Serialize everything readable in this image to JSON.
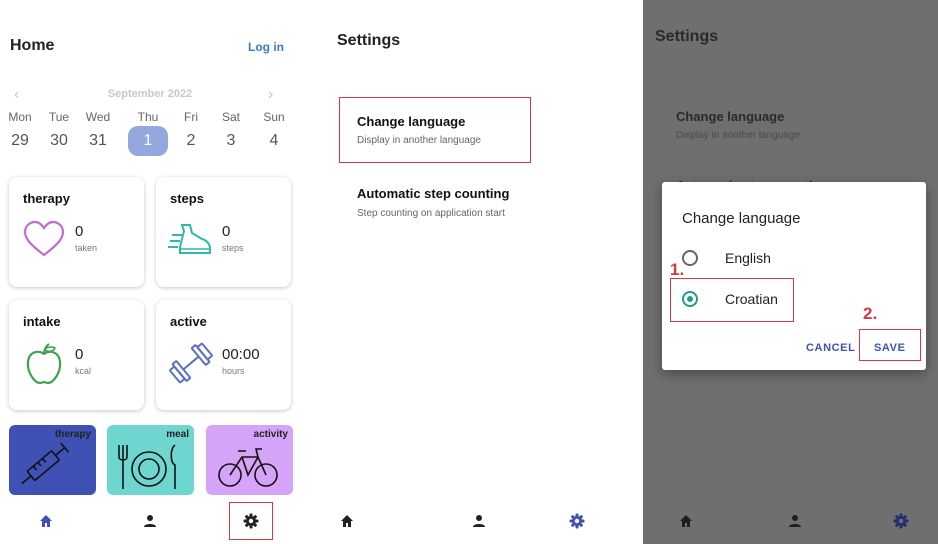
{
  "home": {
    "title": "Home",
    "login_label": "Log in",
    "calendar": {
      "prev_icon": "chevron-left-icon",
      "next_icon": "chevron-right-icon",
      "month": "September 2022",
      "days": [
        {
          "name": "Mon",
          "date": "29"
        },
        {
          "name": "Tue",
          "date": "30"
        },
        {
          "name": "Wed",
          "date": "31"
        },
        {
          "name": "Thu",
          "date": "1",
          "selected": true
        },
        {
          "name": "Fri",
          "date": "2"
        },
        {
          "name": "Sat",
          "date": "3"
        },
        {
          "name": "Sun",
          "date": "4"
        }
      ]
    },
    "cards": {
      "therapy": {
        "title": "therapy",
        "value": "0",
        "unit": "taken",
        "icon": "heart-icon"
      },
      "steps": {
        "title": "steps",
        "value": "0",
        "unit": "steps",
        "icon": "shoe-icon"
      },
      "intake": {
        "title": "intake",
        "value": "0",
        "unit": "kcal",
        "icon": "apple-icon"
      },
      "active": {
        "title": "active",
        "value": "00:00",
        "unit": "hours",
        "icon": "dumbbell-icon"
      }
    },
    "tiles": [
      {
        "label": "therapy",
        "icon": "syringe-icon",
        "color": "#3f51b5"
      },
      {
        "label": "meal",
        "icon": "cutlery-plate-icon",
        "color": "#6fd6cf"
      },
      {
        "label": "activity",
        "icon": "bicycle-icon",
        "color": "#d5a3f7"
      }
    ]
  },
  "nav": {
    "icons": [
      "home-icon",
      "person-icon",
      "gear-icon"
    ],
    "active_color": "#3f51b5",
    "inactive_color": "#222222"
  },
  "settings": {
    "title": "Settings",
    "options": [
      {
        "title": "Change language",
        "subtitle": "Display in another language"
      },
      {
        "title": "Automatic step counting",
        "subtitle": "Step counting on application start"
      }
    ]
  },
  "dialog": {
    "title": "Change language",
    "options": [
      {
        "label": "English",
        "selected": false
      },
      {
        "label": "Croatian",
        "selected": true
      }
    ],
    "cancel_label": "CANCEL",
    "save_label": "SAVE",
    "step1": "1.",
    "step2": "2."
  },
  "colors": {
    "highlight": "#d8383f",
    "selected_day": "#94a8de",
    "link": "#3a7bd5",
    "radio_selected": "#1e9e8a",
    "overlay": "#6f6f6f"
  }
}
